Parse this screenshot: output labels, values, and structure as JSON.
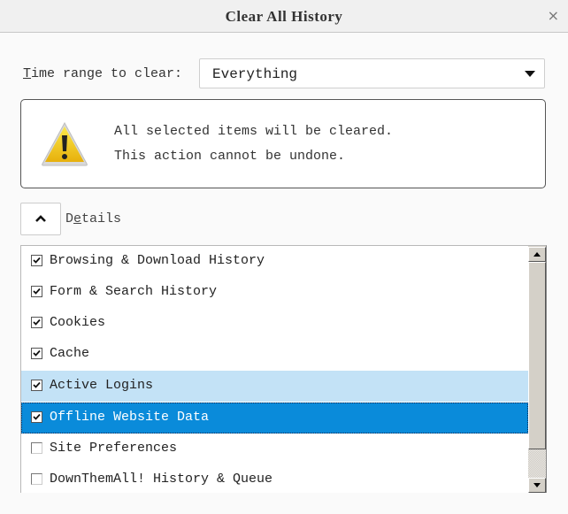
{
  "window": {
    "title": "Clear All History",
    "close_icon": "×"
  },
  "time_range": {
    "label_prefix": "T",
    "label_rest": "ime range to clear:",
    "selected": "Everything"
  },
  "warning": {
    "icon": "warning-triangle-icon",
    "line1": "All selected items will be cleared.",
    "line2": "This action cannot be undone."
  },
  "details": {
    "label_first": "D",
    "label_accel": "e",
    "label_rest": "tails",
    "expanded": true
  },
  "items": [
    {
      "label": "Browsing & Download History",
      "checked": true,
      "state": "normal"
    },
    {
      "label": "Form & Search History",
      "checked": true,
      "state": "normal"
    },
    {
      "label": "Cookies",
      "checked": true,
      "state": "normal"
    },
    {
      "label": "Cache",
      "checked": true,
      "state": "normal"
    },
    {
      "label": "Active Logins",
      "checked": true,
      "state": "hover"
    },
    {
      "label": "Offline Website Data",
      "checked": true,
      "state": "selected"
    },
    {
      "label": "Site Preferences",
      "checked": false,
      "state": "normal"
    },
    {
      "label": "DownThemAll! History & Queue",
      "checked": false,
      "state": "normal"
    }
  ],
  "colors": {
    "hover_row": "#c3e2f6",
    "selected_row": "#0a8bda"
  }
}
